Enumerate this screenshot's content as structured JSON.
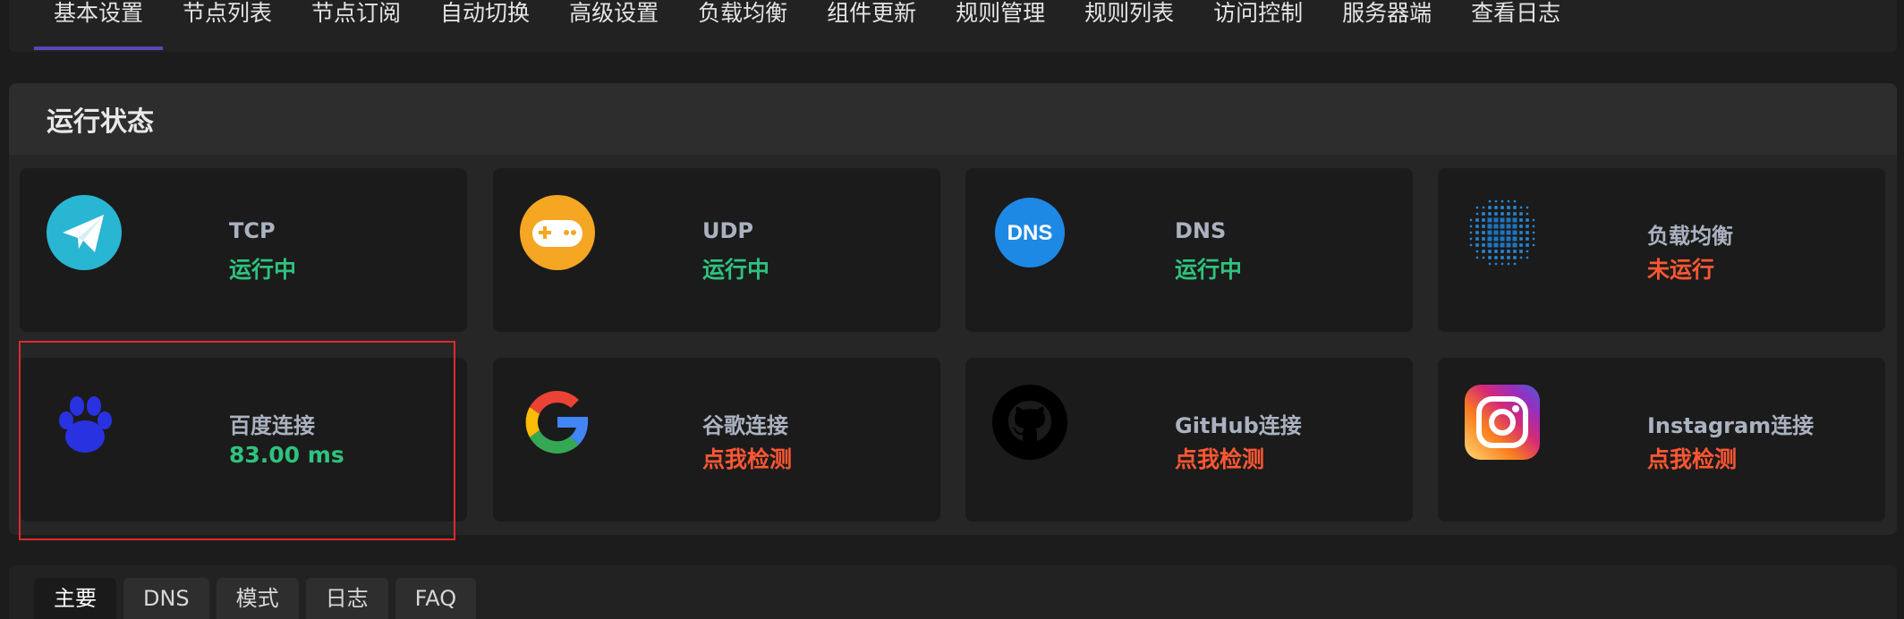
{
  "nav": {
    "tabs": [
      "基本设置",
      "节点列表",
      "节点订阅",
      "自动切换",
      "高级设置",
      "负载均衡",
      "组件更新",
      "规则管理",
      "规则列表",
      "访问控制",
      "服务器端",
      "查看日志"
    ],
    "active_index": 0
  },
  "status_panel": {
    "title": "运行状态",
    "cards": [
      {
        "name": "TCP",
        "status": "运行中",
        "icon": "paper-plane-icon"
      },
      {
        "name": "UDP",
        "status": "运行中",
        "icon": "gamepad-icon"
      },
      {
        "name": "DNS",
        "status": "运行中",
        "icon": "dns-icon",
        "icon_text": "DNS"
      },
      {
        "name": "负载均衡",
        "status": "未运行",
        "icon": "dotted-globe-icon"
      },
      {
        "name": "百度连接",
        "status": "83.00 ms",
        "icon": "baidu-paw-icon"
      },
      {
        "name": "谷歌连接",
        "status": "点我检测",
        "icon": "google-icon"
      },
      {
        "name": "GitHub连接",
        "status": "点我检测",
        "icon": "github-icon"
      },
      {
        "name": "Instagram连接",
        "status": "点我检测",
        "icon": "instagram-icon"
      }
    ]
  },
  "bottom_tabs": {
    "tabs": [
      "主要",
      "DNS",
      "模式",
      "日志",
      "FAQ"
    ],
    "active_index": 0
  },
  "colors": {
    "status_ok": "#2ec27e",
    "status_bad": "#ff5733",
    "accent": "#5a48b8",
    "highlight_border": "#e0282e"
  }
}
